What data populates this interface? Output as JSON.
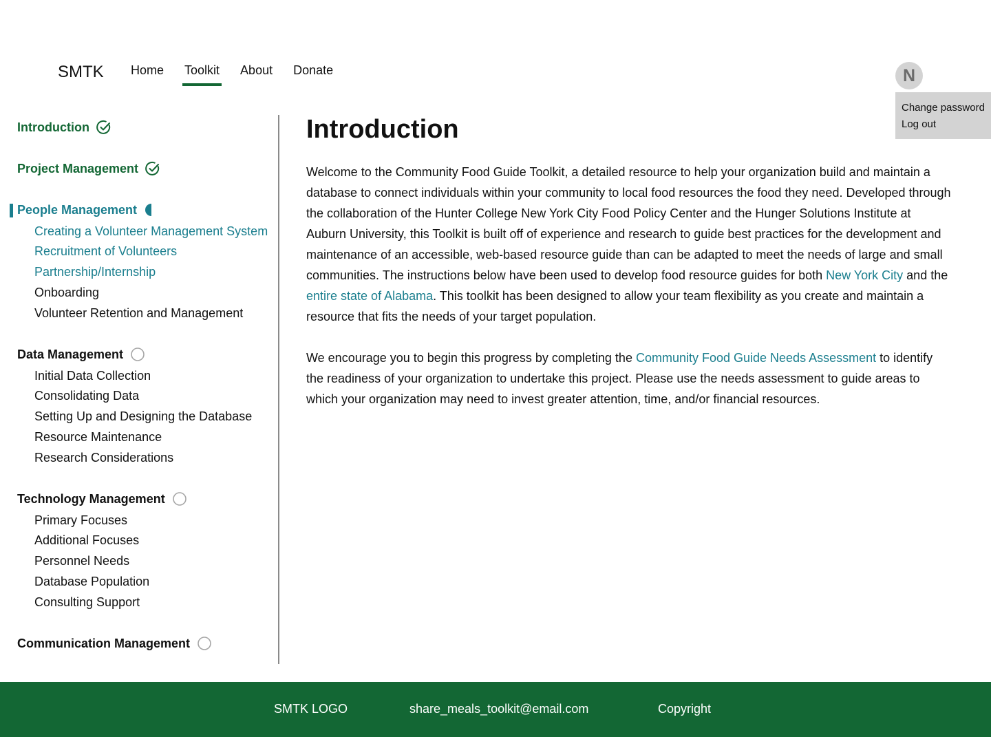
{
  "header": {
    "brand": "SMTK",
    "nav": [
      "Home",
      "Toolkit",
      "About",
      "Donate"
    ],
    "active_nav": "Toolkit",
    "avatar_initial": "N",
    "user_menu": [
      "Change password",
      "Log out"
    ]
  },
  "sidebar": {
    "sections": [
      {
        "title": "Introduction",
        "status": "complete",
        "items": []
      },
      {
        "title": "Project Management",
        "status": "complete",
        "items": []
      },
      {
        "title": "People Management",
        "status": "in-progress",
        "items": [
          "Creating a Volunteer Management System",
          "Recruitment of Volunteers",
          "Partnership/Internship",
          "Onboarding",
          "Volunteer Retention and Management"
        ]
      },
      {
        "title": "Data Management",
        "status": "not-started",
        "items": [
          "Initial Data Collection",
          "Consolidating Data",
          "Setting Up and Designing the Database",
          "Resource Maintenance",
          "Research Considerations"
        ]
      },
      {
        "title": "Technology Management",
        "status": "not-started",
        "items": [
          "Primary Focuses",
          "Additional Focuses",
          "Personnel Needs",
          "Database Population",
          "Consulting Support"
        ]
      },
      {
        "title": "Communication Management",
        "status": "not-started",
        "items": []
      }
    ]
  },
  "main": {
    "title": "Introduction",
    "p1_before_link1": "Welcome to the Community Food Guide Toolkit, a detailed resource to help your organization build and maintain a database to connect individuals within your community to local food resources the food they need.  Developed through the collaboration of the Hunter College New York City Food Policy Center and the Hunger Solutions Institute at Auburn University, this Toolkit is built off of experience and research to guide best practices for the development and maintenance of an accessible, web-based resource guide than can be adapted to meet the needs of large and small communities.  The instructions below have been used to develop food resource guides for both ",
    "p1_link1": "New York City",
    "p1_between": " and the ",
    "p1_link2": "entire state of Alabama",
    "p1_after": ".  This toolkit has been designed to allow your team flexibility as you create and maintain a resource that fits the needs of your target population.",
    "p2_before": "We encourage you to begin this progress by completing the ",
    "p2_link": "Community Food Guide Needs Assessment",
    "p2_after": " to identify the readiness of your organization to undertake this project.  Please use the needs assessment to guide areas to which your organization may need to invest greater attention, time, and/or financial resources."
  },
  "footer": {
    "logo": "SMTK LOGO",
    "email": "share_meals_toolkit@email.com",
    "copyright": "Copyright"
  },
  "colors": {
    "brand_green": "#136734",
    "link_teal": "#1a7e8e",
    "menu_gray": "#d3d3d3"
  }
}
